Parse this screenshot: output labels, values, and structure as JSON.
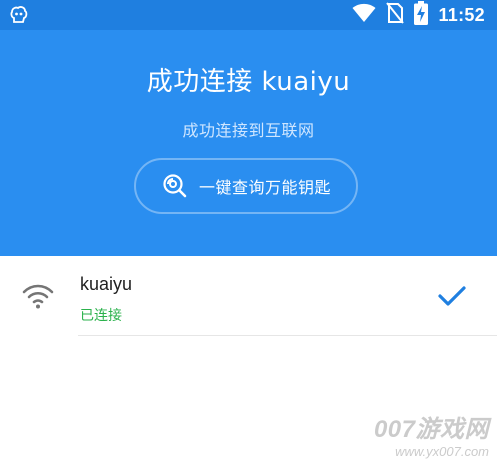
{
  "status_bar": {
    "time": "11:52",
    "left_icon": "app-notification-icon",
    "icons": [
      "wifi-icon",
      "no-sim-icon",
      "battery-charging-icon"
    ],
    "background": "#1f7fe0"
  },
  "header": {
    "title": "成功连接 kuaiyu",
    "subtitle": "成功连接到互联网",
    "button_label": "一键查询万能钥匙",
    "button_icon": "search-key-icon",
    "background": "#2a8ef0"
  },
  "networks": [
    {
      "name": "kuaiyu",
      "status": "已连接",
      "icon": "wifi-signal-icon",
      "checked": true,
      "status_color": "#2bb24c",
      "check_color": "#1f7fe0"
    }
  ],
  "watermark": {
    "main": "007游戏网",
    "url": "www.yx007.com"
  }
}
